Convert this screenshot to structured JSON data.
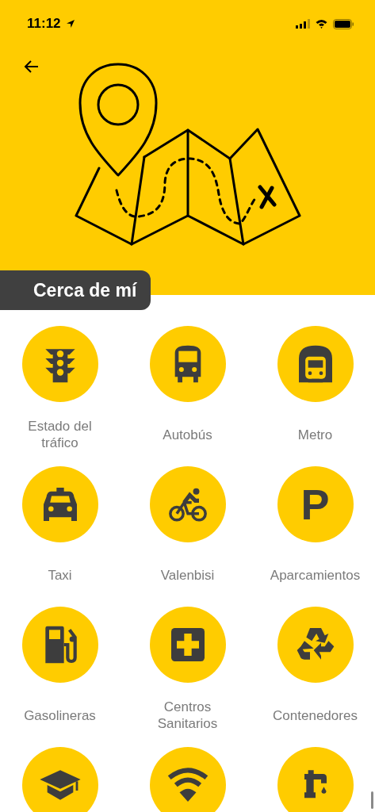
{
  "status_bar": {
    "time": "11:12"
  },
  "section_tag": {
    "title": "Cerca de mí"
  },
  "items": [
    {
      "kind": "traffic-light",
      "label": "Estado del tráfico"
    },
    {
      "kind": "bus",
      "label": "Autobús"
    },
    {
      "kind": "metro",
      "label": "Metro"
    },
    {
      "kind": "taxi",
      "label": "Taxi"
    },
    {
      "kind": "bicycle",
      "label": "Valenbisi"
    },
    {
      "kind": "parking",
      "glyph": "P",
      "label": "Aparcamientos"
    },
    {
      "kind": "fuel",
      "label": "Gasolineras"
    },
    {
      "kind": "medical",
      "label": "Centros Sanitarios"
    },
    {
      "kind": "recycle",
      "label": "Contenedores"
    },
    {
      "kind": "graduation"
    },
    {
      "kind": "wifi"
    },
    {
      "kind": "tap"
    }
  ]
}
